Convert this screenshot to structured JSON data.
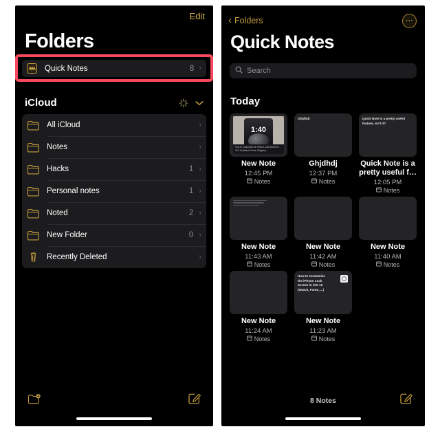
{
  "left_panel": {
    "edit_label": "Edit",
    "title": "Folders",
    "quick_notes": {
      "icon": "quick-note-icon",
      "label": "Quick Notes",
      "count": "8",
      "chevron": "›",
      "highlighted": true,
      "highlight_color": "#f8485e"
    },
    "section": {
      "label": "iCloud",
      "spinner": "activity-spinner",
      "chevron": "⌄"
    },
    "folders": [
      {
        "icon": "folder-icon",
        "name": "All iCloud",
        "count": "",
        "chevron": "›"
      },
      {
        "icon": "folder-icon",
        "name": "Notes",
        "count": "",
        "chevron": "›"
      },
      {
        "icon": "folder-icon",
        "name": "Hacks",
        "count": "1",
        "chevron": "›"
      },
      {
        "icon": "folder-icon",
        "name": "Personal notes",
        "count": "1",
        "chevron": "›"
      },
      {
        "icon": "folder-icon",
        "name": "Noted",
        "count": "2",
        "chevron": "›"
      },
      {
        "icon": "folder-icon",
        "name": "New Folder",
        "count": "0",
        "chevron": "›"
      },
      {
        "icon": "trash-icon",
        "name": "Recently Deleted",
        "count": "",
        "chevron": "›"
      }
    ],
    "toolbar": {
      "new_folder_icon": "new-folder-icon",
      "compose_icon": "compose-icon"
    }
  },
  "right_panel": {
    "back_label": "Folders",
    "back_icon": "chevron-left-icon",
    "more_icon": "more-ellipsis-icon",
    "title": "Quick Notes",
    "search": {
      "placeholder": "Search",
      "icon": "search-icon"
    },
    "section_label": "Today",
    "notes": [
      {
        "title": "New Note",
        "time": "12:45 PM",
        "folder": "Notes",
        "folder_icon": "notes-folder-icon",
        "thumb_type": "image",
        "thumb_clock": "1:40",
        "thumb_caption": "How to Customize the iPhone Lock Screen in iOS 16 (Watch, Fonts, Widgets)"
      },
      {
        "title": "Ghjdhdj",
        "time": "12:37 PM",
        "folder": "Notes",
        "folder_icon": "notes-folder-icon",
        "thumb_type": "text",
        "thumb_text": "Ghjdhdj"
      },
      {
        "title": "Quick Note is a pretty useful f…",
        "time": "12:05 PM",
        "folder": "Notes",
        "folder_icon": "notes-folder-icon",
        "thumb_type": "text",
        "thumb_text": "Quick Note is a pretty useful feature, isn't it?"
      },
      {
        "title": "New Note",
        "time": "11:43 AM",
        "folder": "Notes",
        "folder_icon": "notes-folder-icon",
        "thumb_type": "lines"
      },
      {
        "title": "New Note",
        "time": "11:42 AM",
        "folder": "Notes",
        "folder_icon": "notes-folder-icon",
        "thumb_type": "blank"
      },
      {
        "title": "New Note",
        "time": "11:40 AM",
        "folder": "Notes",
        "folder_icon": "notes-folder-icon",
        "thumb_type": "blank"
      },
      {
        "title": "New Note",
        "time": "11:24 AM",
        "folder": "Notes",
        "folder_icon": "notes-folder-icon",
        "thumb_type": "blank"
      },
      {
        "title": "New Note",
        "time": "11:23 AM",
        "folder": "Notes",
        "folder_icon": "notes-folder-icon",
        "thumb_type": "link",
        "thumb_text": "How to Customize the iPhone Lock Screen in iOS 16 (Watch, Fonts, ...)"
      }
    ],
    "footer": {
      "notes_count": "8 Notes",
      "compose_icon": "compose-icon"
    }
  },
  "colors": {
    "accent_gold": "#c49b3c",
    "highlight_red": "#f8485e",
    "background": "#000000",
    "card": "#1c1c1e",
    "secondary_text": "#8e8e93"
  }
}
